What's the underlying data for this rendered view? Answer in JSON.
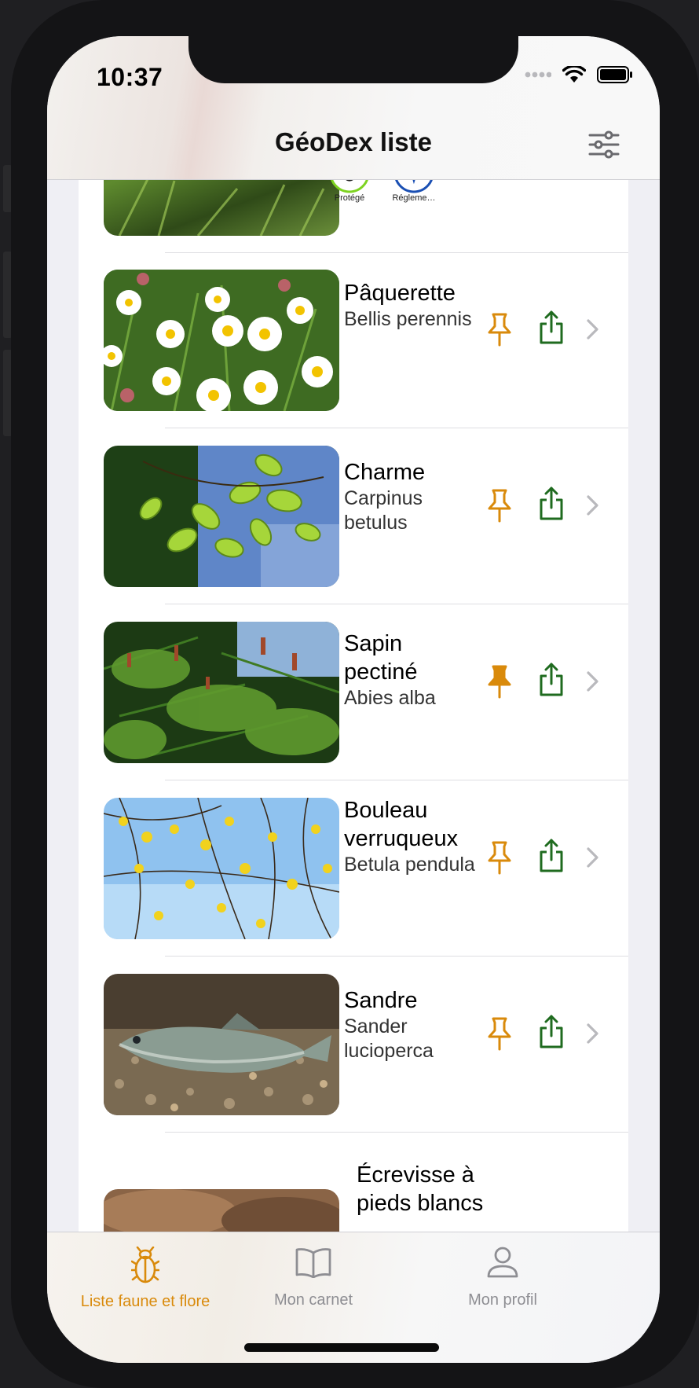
{
  "status": {
    "time": "10:37"
  },
  "nav": {
    "title": "GéoDex liste",
    "filter_icon": "sliders-icon"
  },
  "partial_top": {
    "badges": [
      {
        "label": "Protégé",
        "icon": "protected-badge-icon",
        "color": "#7ed321"
      },
      {
        "label": "Régleme…",
        "icon": "regulation-badge-icon",
        "color": "#1a4fb3"
      }
    ]
  },
  "species": [
    {
      "common": "Pâquerette",
      "latin": "Bellis perennis",
      "pinned": false
    },
    {
      "common": "Charme",
      "latin": "Carpinus betulus",
      "pinned": false
    },
    {
      "common": "Sapin pectiné",
      "latin": "Abies alba",
      "pinned": true
    },
    {
      "common": "Bouleau verruqueux",
      "latin": "Betula pendula",
      "pinned": false
    },
    {
      "common": "Sandre",
      "latin": "Sander lucioperca",
      "pinned": false
    },
    {
      "common": "Écrevisse à pieds blancs",
      "latin": "",
      "pinned": false
    }
  ],
  "tabs": [
    {
      "label": "Liste faune et flore",
      "icon": "beetle-icon",
      "active": true
    },
    {
      "label": "Mon carnet",
      "icon": "book-icon",
      "active": false
    },
    {
      "label": "Mon profil",
      "icon": "person-icon",
      "active": false
    }
  ],
  "colors": {
    "accent": "#d98a0b",
    "share": "#1f6b1f",
    "inactive_tab": "#8e8e93"
  }
}
